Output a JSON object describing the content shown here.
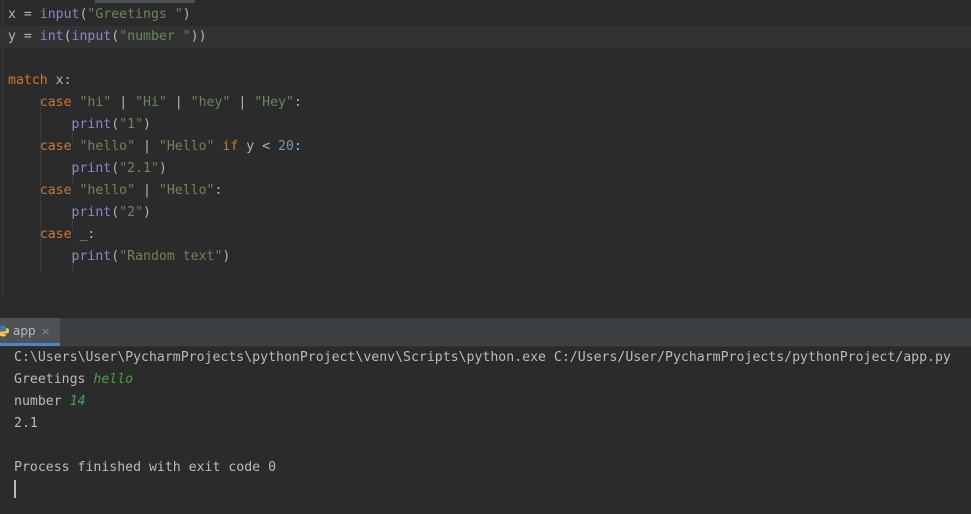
{
  "editor": {
    "lines": [
      {
        "tokens": [
          {
            "t": "x = ",
            "c": "txt"
          },
          {
            "t": "input",
            "c": "bi"
          },
          {
            "t": "(",
            "c": "txt"
          },
          {
            "t": "\"Greetings \"",
            "c": "str"
          },
          {
            "t": ")",
            "c": "txt"
          }
        ]
      },
      {
        "tokens": [
          {
            "t": "y = ",
            "c": "txt"
          },
          {
            "t": "int",
            "c": "bi"
          },
          {
            "t": "(",
            "c": "txt"
          },
          {
            "t": "input",
            "c": "bi"
          },
          {
            "t": "(",
            "c": "txt"
          },
          {
            "t": "\"number \"",
            "c": "str"
          },
          {
            "t": "))",
            "c": "txt"
          }
        ]
      },
      {
        "tokens": []
      },
      {
        "tokens": [
          {
            "t": "match",
            "c": "kw"
          },
          {
            "t": " x:",
            "c": "txt"
          }
        ]
      },
      {
        "tokens": [
          {
            "t": "    ",
            "c": "txt"
          },
          {
            "t": "case",
            "c": "kw"
          },
          {
            "t": " ",
            "c": "txt"
          },
          {
            "t": "\"hi\"",
            "c": "str"
          },
          {
            "t": " | ",
            "c": "txt"
          },
          {
            "t": "\"Hi\"",
            "c": "str"
          },
          {
            "t": " | ",
            "c": "txt"
          },
          {
            "t": "\"hey\"",
            "c": "str"
          },
          {
            "t": " | ",
            "c": "txt"
          },
          {
            "t": "\"Hey\"",
            "c": "str"
          },
          {
            "t": ":",
            "c": "txt"
          }
        ]
      },
      {
        "tokens": [
          {
            "t": "        ",
            "c": "txt"
          },
          {
            "t": "print",
            "c": "bi"
          },
          {
            "t": "(",
            "c": "txt"
          },
          {
            "t": "\"1\"",
            "c": "str"
          },
          {
            "t": ")",
            "c": "txt"
          }
        ]
      },
      {
        "tokens": [
          {
            "t": "    ",
            "c": "txt"
          },
          {
            "t": "case",
            "c": "kw"
          },
          {
            "t": " ",
            "c": "txt"
          },
          {
            "t": "\"hello\"",
            "c": "str"
          },
          {
            "t": " | ",
            "c": "txt"
          },
          {
            "t": "\"Hello\"",
            "c": "str"
          },
          {
            "t": " ",
            "c": "txt"
          },
          {
            "t": "if",
            "c": "kw"
          },
          {
            "t": " y < ",
            "c": "txt"
          },
          {
            "t": "20",
            "c": "num"
          },
          {
            "t": ":",
            "c": "txt"
          }
        ]
      },
      {
        "tokens": [
          {
            "t": "        ",
            "c": "txt"
          },
          {
            "t": "print",
            "c": "bi"
          },
          {
            "t": "(",
            "c": "txt"
          },
          {
            "t": "\"2.1\"",
            "c": "str"
          },
          {
            "t": ")",
            "c": "txt"
          }
        ]
      },
      {
        "tokens": [
          {
            "t": "    ",
            "c": "txt"
          },
          {
            "t": "case",
            "c": "kw"
          },
          {
            "t": " ",
            "c": "txt"
          },
          {
            "t": "\"hello\"",
            "c": "str"
          },
          {
            "t": " | ",
            "c": "txt"
          },
          {
            "t": "\"Hello\"",
            "c": "str"
          },
          {
            "t": ":",
            "c": "txt"
          }
        ]
      },
      {
        "tokens": [
          {
            "t": "        ",
            "c": "txt"
          },
          {
            "t": "print",
            "c": "bi"
          },
          {
            "t": "(",
            "c": "txt"
          },
          {
            "t": "\"2\"",
            "c": "str"
          },
          {
            "t": ")",
            "c": "txt"
          }
        ]
      },
      {
        "tokens": [
          {
            "t": "    ",
            "c": "txt"
          },
          {
            "t": "case",
            "c": "kw"
          },
          {
            "t": " _:",
            "c": "txt"
          }
        ]
      },
      {
        "tokens": [
          {
            "t": "        ",
            "c": "txt"
          },
          {
            "t": "print",
            "c": "bi"
          },
          {
            "t": "(",
            "c": "txt"
          },
          {
            "t": "\"Random text\"",
            "c": "str"
          },
          {
            "t": ")",
            "c": "txt"
          }
        ]
      }
    ],
    "current_line_index": 1
  },
  "run_panel": {
    "tab_label": "app",
    "tab_close": "×",
    "tab_icon": "python-file-icon"
  },
  "console": {
    "command": "C:\\Users\\User\\PycharmProjects\\pythonProject\\venv\\Scripts\\python.exe C:/Users/User/PycharmProjects/pythonProject/app.py",
    "prompt1": "Greetings ",
    "input1": "hello",
    "prompt2": "number ",
    "input2": "14",
    "output1": "2.1",
    "blank": "",
    "finished": "Process finished with exit code 0"
  },
  "colors": {
    "keyword": "#cc7832",
    "builtin": "#8888c6",
    "string": "#6a8759",
    "number": "#6897bb",
    "text": "#a9b7c6",
    "user_input": "#46a346",
    "background": "#2b2b2b",
    "tab_accent": "#4a88c7"
  }
}
